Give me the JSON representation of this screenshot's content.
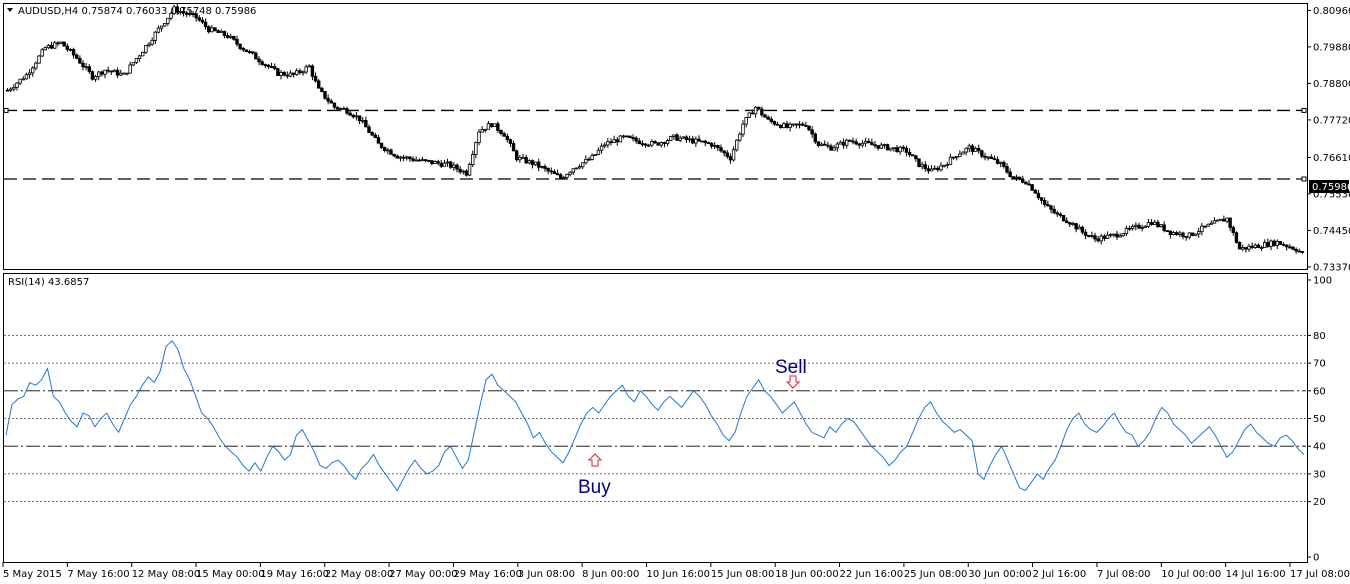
{
  "window": {
    "symbol_header": "AUDUSD,H4  0.75874 0.76033 0.75748 0.75986",
    "last_price": "0.75986"
  },
  "indicator": {
    "label": "RSI(14) 43.6857",
    "levels": [
      80,
      70,
      60,
      50,
      40,
      30,
      20
    ]
  },
  "signals": {
    "buy_label": "Buy",
    "sell_label": "Sell"
  },
  "colors": {
    "rsi_line": "#1e78dc",
    "signal_text": "#000080",
    "arrow": "#e0202a",
    "candle": "#000000",
    "price_tag_bg": "#000000",
    "price_tag_text": "#ffffff"
  },
  "chart_data": [
    {
      "type": "candlestick",
      "title": "AUDUSD,H4",
      "ylim": [
        0.73337,
        0.8112
      ],
      "y_ticks": [
        "0.80960",
        "0.79880",
        "0.78800",
        "0.77720",
        "0.76610",
        "0.75530",
        "0.74450",
        "0.73370"
      ],
      "x_ticks": [
        "5 May 2015",
        "7 May 16:00",
        "12 May 08:00",
        "15 May 00:00",
        "19 May 16:00",
        "22 May 08:00",
        "27 May 00:00",
        "29 May 16:00",
        "3 Jun 08:00",
        "8 Jun 00:00",
        "10 Jun 16:00",
        "15 Jun 08:00",
        "18 Jun 00:00",
        "22 Jun 16:00",
        "25 Jun 08:00",
        "30 Jun 00:00",
        "2 Jul 16:00",
        "7 Jul 08:00",
        "10 Jul 00:00",
        "14 Jul 16:00",
        "17 Jul 08:00"
      ],
      "horizontal_lines": [
        0.78,
        0.7597
      ],
      "close_path": [
        [
          0,
          0.786
        ],
        [
          6,
          0.7905
        ],
        [
          12,
          0.7985
        ],
        [
          17,
          0.8
        ],
        [
          22,
          0.7955
        ],
        [
          27,
          0.79
        ],
        [
          31,
          0.792
        ],
        [
          37,
          0.7905
        ],
        [
          44,
          0.799
        ],
        [
          48,
          0.804
        ],
        [
          53,
          0.81
        ],
        [
          60,
          0.8075
        ],
        [
          64,
          0.804
        ],
        [
          70,
          0.802
        ],
        [
          74,
          0.799
        ],
        [
          80,
          0.795
        ],
        [
          86,
          0.791
        ],
        [
          91,
          0.7905
        ],
        [
          96,
          0.793
        ],
        [
          99,
          0.786
        ],
        [
          104,
          0.781
        ],
        [
          108,
          0.78
        ],
        [
          112,
          0.7775
        ],
        [
          118,
          0.77
        ],
        [
          124,
          0.7665
        ],
        [
          132,
          0.765
        ],
        [
          140,
          0.764
        ],
        [
          146,
          0.7615
        ],
        [
          150,
          0.774
        ],
        [
          154,
          0.776
        ],
        [
          158,
          0.773
        ],
        [
          162,
          0.766
        ],
        [
          168,
          0.764
        ],
        [
          172,
          0.762
        ],
        [
          176,
          0.76
        ],
        [
          180,
          0.763
        ],
        [
          186,
          0.766
        ],
        [
          190,
          0.77
        ],
        [
          196,
          0.772
        ],
        [
          200,
          0.771
        ],
        [
          206,
          0.77
        ],
        [
          212,
          0.772
        ],
        [
          218,
          0.771
        ],
        [
          224,
          0.77
        ],
        [
          230,
          0.766
        ],
        [
          234,
          0.776
        ],
        [
          238,
          0.781
        ],
        [
          242,
          0.777
        ],
        [
          248,
          0.775
        ],
        [
          254,
          0.776
        ],
        [
          258,
          0.77
        ],
        [
          262,
          0.769
        ],
        [
          268,
          0.771
        ],
        [
          274,
          0.77
        ],
        [
          280,
          0.769
        ],
        [
          286,
          0.768
        ],
        [
          290,
          0.764
        ],
        [
          294,
          0.762
        ],
        [
          298,
          0.764
        ],
        [
          302,
          0.767
        ],
        [
          306,
          0.769
        ],
        [
          310,
          0.767
        ],
        [
          316,
          0.764
        ],
        [
          320,
          0.76
        ],
        [
          324,
          0.759
        ],
        [
          327,
          0.756
        ],
        [
          330,
          0.752
        ],
        [
          334,
          0.749
        ],
        [
          338,
          0.747
        ],
        [
          342,
          0.744
        ],
        [
          346,
          0.742
        ],
        [
          352,
          0.743
        ],
        [
          358,
          0.745
        ],
        [
          364,
          0.747
        ],
        [
          370,
          0.744
        ],
        [
          376,
          0.743
        ],
        [
          380,
          0.745
        ],
        [
          385,
          0.747
        ],
        [
          388,
          0.748
        ],
        [
          392,
          0.739
        ],
        [
          398,
          0.74
        ],
        [
          404,
          0.741
        ],
        [
          410,
          0.739
        ],
        [
          412,
          0.7375
        ]
      ]
    },
    {
      "type": "line",
      "title": "RSI(14) 43.6857",
      "ylim": [
        0,
        100
      ],
      "y_ticks": [
        100,
        80,
        70,
        60,
        50,
        40,
        30,
        20,
        0
      ],
      "series": [
        {
          "values": [
            44,
            55,
            57,
            58,
            63,
            62,
            64,
            68,
            58,
            56,
            52,
            49,
            47,
            52,
            51,
            47,
            50,
            52,
            48,
            45,
            50,
            55,
            58,
            62,
            65,
            63,
            67,
            76,
            78,
            75,
            68,
            64,
            58,
            52,
            50,
            47,
            43,
            40,
            38,
            36,
            33,
            31,
            34,
            31,
            36,
            40,
            38,
            35,
            37,
            44,
            46,
            42,
            38,
            33,
            32,
            34,
            35,
            33,
            30,
            28,
            32,
            34,
            37,
            33,
            30,
            27,
            24,
            28,
            32,
            35,
            32,
            30,
            31,
            33,
            38,
            40,
            36,
            32,
            35,
            45,
            55,
            64,
            66,
            62,
            60,
            58,
            56,
            52,
            48,
            43,
            45,
            41,
            38,
            36,
            34,
            38,
            43,
            48,
            52,
            54,
            52,
            55,
            58,
            60,
            62,
            58,
            56,
            60,
            58,
            55,
            53,
            56,
            58,
            56,
            54,
            57,
            60,
            58,
            55,
            51,
            48,
            44,
            42,
            45,
            52,
            58,
            61,
            64,
            60,
            58,
            55,
            52,
            54,
            56,
            52,
            48,
            45,
            44,
            43,
            47,
            45,
            48,
            50,
            49,
            46,
            43,
            40,
            38,
            36,
            33,
            35,
            38,
            40,
            45,
            50,
            54,
            56,
            52,
            49,
            47,
            45,
            46,
            44,
            42,
            30,
            28,
            33,
            37,
            40,
            35,
            30,
            25,
            24,
            27,
            30,
            28,
            32,
            35,
            40,
            46,
            50,
            52,
            48,
            46,
            45,
            47,
            50,
            52,
            48,
            45,
            44,
            40,
            42,
            45,
            50,
            54,
            52,
            48,
            46,
            44,
            41,
            43,
            45,
            47,
            44,
            40,
            36,
            38,
            42,
            46,
            48,
            45,
            43,
            41,
            40,
            43,
            44,
            42,
            39,
            37
          ]
        }
      ],
      "annotations": [
        {
          "label": "Buy",
          "x_index": 95,
          "rsi": 34
        },
        {
          "label": "Sell",
          "x_index": 126,
          "rsi": 63
        }
      ]
    }
  ]
}
